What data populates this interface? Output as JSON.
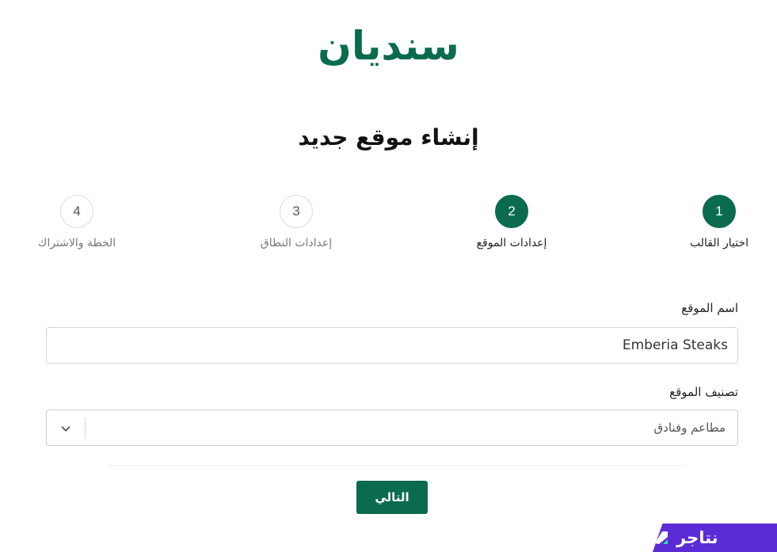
{
  "logo": {
    "text": "سنديان"
  },
  "page": {
    "title": "إنشاء موقع جديد"
  },
  "steps": [
    {
      "number": "1",
      "label": "اختيار القالب",
      "state": "active"
    },
    {
      "number": "2",
      "label": "إعدادات الموقع",
      "state": "active"
    },
    {
      "number": "3",
      "label": "إعدادات النطاق",
      "state": "pending"
    },
    {
      "number": "4",
      "label": "الخطة والاشتراك",
      "state": "pending"
    }
  ],
  "form": {
    "site_name": {
      "label": "اسم الموقع",
      "value": "Emberia Steaks"
    },
    "site_category": {
      "label": "تصنيف الموقع",
      "selected": "مطاعم وفنادق"
    },
    "next_label": "التالي"
  },
  "badge": {
    "text": "نتاجر"
  },
  "colors": {
    "brand": "#0b6b4f",
    "badge": "#5b2bd6"
  }
}
